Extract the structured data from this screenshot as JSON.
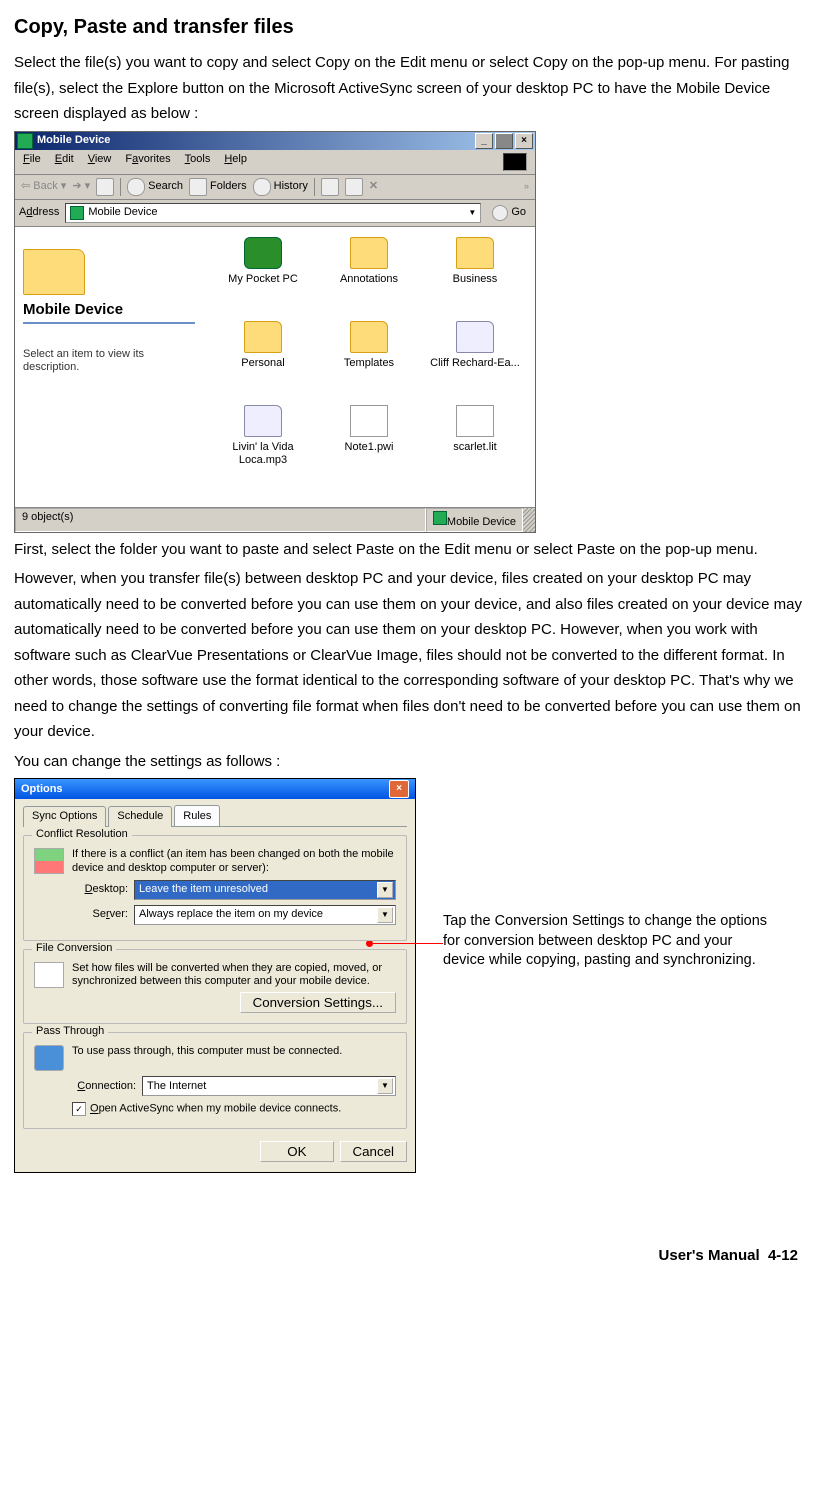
{
  "heading": "Copy, Paste and transfer files",
  "intro": "Select the file(s) you want to copy and select Copy on the Edit menu or select Copy on the pop-up menu. For pasting file(s), select the Explore button on the Microsoft ActiveSync screen of your desktop PC to have the Mobile Device screen displayed as below :",
  "explorer": {
    "title": "Mobile Device",
    "menu": {
      "file": "File",
      "edit": "Edit",
      "view": "View",
      "favorites": "Favorites",
      "tools": "Tools",
      "help": "Help"
    },
    "toolbar": {
      "back": "Back",
      "search": "Search",
      "folders": "Folders",
      "history": "History"
    },
    "address_label": "Address",
    "address_value": "Mobile Device",
    "go": "Go",
    "side": {
      "title": "Mobile Device",
      "desc": "Select an item to view its description."
    },
    "items": [
      {
        "label": "My Pocket PC",
        "icon": "pda"
      },
      {
        "label": "Annotations",
        "icon": "folder"
      },
      {
        "label": "Business",
        "icon": "folder"
      },
      {
        "label": "Personal",
        "icon": "folder"
      },
      {
        "label": "Templates",
        "icon": "folder"
      },
      {
        "label": "Cliff Rechard-Ea...",
        "icon": "audio"
      },
      {
        "label": "Livin' la Vida Loca.mp3",
        "icon": "audio"
      },
      {
        "label": "Note1.pwi",
        "icon": "doc"
      },
      {
        "label": "scarlet.lit",
        "icon": "app"
      }
    ],
    "status_left": "9 object(s)",
    "status_right": "Mobile Device"
  },
  "para2": "First, select the folder you want to paste and select Paste on the Edit menu or select Paste on the pop-up menu.",
  "para3": "However, when you transfer file(s) between desktop PC and your device, files created on your desktop PC may automatically need to be converted before you can use them on your device, and also files created on your device may automatically need to be converted before you can use them on your desktop PC. However, when you work with software such as ClearVue Presentations or ClearVue Image, files should not be converted to the different format. In other words, those software use the format identical to the corresponding software of your desktop PC. That's why we need to change the settings of converting file format when files don't need to be converted before you can use them on your device.",
  "para4": "You can change the settings as follows :",
  "options": {
    "title": "Options",
    "tabs": {
      "sync": "Sync Options",
      "schedule": "Schedule",
      "rules": "Rules"
    },
    "group1": {
      "legend": "Conflict Resolution",
      "desc": "If there is a conflict (an item has been changed on both the mobile device and desktop computer or server):",
      "desktop_lbl": "Desktop:",
      "desktop_val": "Leave the item unresolved",
      "server_lbl": "Server:",
      "server_val": "Always replace the item on my device"
    },
    "group2": {
      "legend": "File Conversion",
      "desc": "Set how files will be converted when they are copied, moved, or synchronized between this computer and your mobile device.",
      "btn": "Conversion Settings..."
    },
    "group3": {
      "legend": "Pass Through",
      "desc": "To use pass through, this computer must be connected.",
      "conn_lbl": "Connection:",
      "conn_val": "The Internet",
      "cb": "Open ActiveSync when my mobile device connects."
    },
    "ok": "OK",
    "cancel": "Cancel"
  },
  "annotation": "Tap the Conversion Settings to change the options for conversion between desktop PC and your device while copying, pasting and synchronizing.",
  "footer_label": "User's Manual",
  "footer_page": "4-12"
}
